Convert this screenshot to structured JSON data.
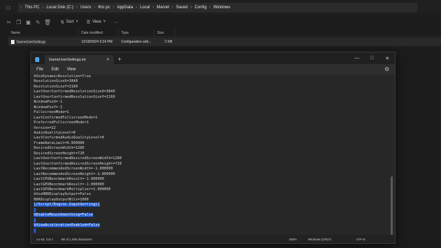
{
  "explorer": {
    "breadcrumbs": [
      "This PC",
      "Local Disk (C:)",
      "Users",
      "this pc",
      "AppData",
      "Local",
      "Marvel",
      "Saved",
      "Config",
      "Windows"
    ],
    "toolbar": {
      "sort_label": "Sort",
      "view_label": "View",
      "more_label": "…"
    },
    "columns": [
      "Name",
      "Date modified",
      "Type",
      "Size"
    ],
    "files": [
      {
        "name": "GameUserSettings",
        "date": "12/18/2024 3:24 PM",
        "type": "Configuration sett...",
        "size": "2 KB"
      }
    ]
  },
  "notepad": {
    "tab_title": "GameUserSettings.ini",
    "new_tab_label": "+",
    "menu": [
      "File",
      "Edit",
      "View"
    ],
    "lines": [
      "bUseDynamicResolution=True",
      "ResolutionSizeX=3840",
      "ResolutionSizeY=2160",
      "LastUserConfirmedResolutionSizeX=3840",
      "LastUserConfirmedResolutionSizeY=2160",
      "WindowPosX=-1",
      "WindowPosY=-1",
      "FullscreenMode=1",
      "LastConfirmedFullscreenMode=1",
      "PreferredFullscreenMode=1",
      "Version=22",
      "AudioQualityLevel=0",
      "LastConfirmedAudioQualityLevel=0",
      "FrameRateLimit=0.000000",
      "DesiredScreenWidth=1280",
      "DesiredScreenHeight=720",
      "LastUserConfirmedDesiredScreenWidth=1280",
      "LastUserConfirmedDesiredScreenHeight=720",
      "LastRecommendedScreenWidth=-1.000000",
      "LastRecommendedScreenHeight=-1.000000",
      "LastCPUBenchmarkResult=-1.000000",
      "LastGPUBenchmarkResult=-1.000000",
      "LastGPUBenchmarkMultiplier=1.000000",
      "bUseHDRDisplayOutput=False",
      "HDRDisplayOutputNits=1000",
      "[/Script/Engine.InputSettings]",
      "",
      "bEnableMouseSmoothing=False",
      "",
      "bViewAccelerationEnabled=False",
      ""
    ],
    "selected_from": 25,
    "status": {
      "position": "Ln 63, Col 1",
      "chars": "99 of 1,409 characters",
      "zoom": "100%",
      "line_ending": "Windows (CRLF)",
      "encoding": "UTF-8"
    }
  }
}
